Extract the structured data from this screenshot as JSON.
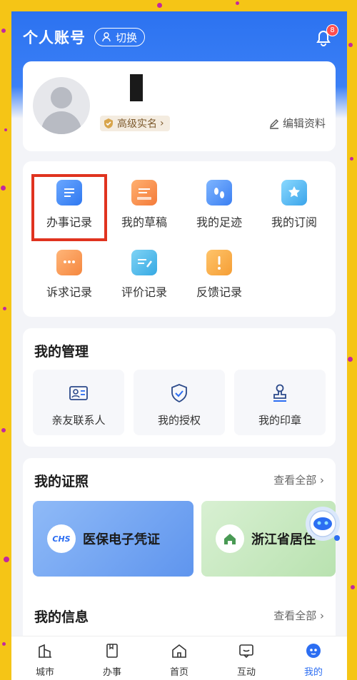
{
  "header": {
    "title": "个人账号",
    "switch_label": "切换",
    "notification_count": "8"
  },
  "profile": {
    "verify_label": "高级实名",
    "edit_label": "编辑资料"
  },
  "records": [
    {
      "label": "办事记录",
      "icon": "document-icon"
    },
    {
      "label": "我的草稿",
      "icon": "draft-icon"
    },
    {
      "label": "我的足迹",
      "icon": "footprint-icon"
    },
    {
      "label": "我的订阅",
      "icon": "bookmark-icon"
    },
    {
      "label": "诉求记录",
      "icon": "chat-icon"
    },
    {
      "label": "评价记录",
      "icon": "review-icon"
    },
    {
      "label": "反馈记录",
      "icon": "feedback-icon"
    }
  ],
  "management": {
    "title": "我的管理",
    "items": [
      {
        "label": "亲友联系人",
        "icon": "contact-card-icon"
      },
      {
        "label": "我的授权",
        "icon": "shield-check-icon"
      },
      {
        "label": "我的印章",
        "icon": "stamp-icon"
      }
    ]
  },
  "license": {
    "title": "我的证照",
    "see_all": "查看全部",
    "cards": [
      {
        "label": "医保电子凭证",
        "logo": "CHS"
      },
      {
        "label": "浙江省居住"
      }
    ]
  },
  "info": {
    "title": "我的信息",
    "see_all": "查看全部"
  },
  "tabbar": [
    {
      "label": "城市",
      "icon": "city-icon"
    },
    {
      "label": "办事",
      "icon": "task-icon"
    },
    {
      "label": "首页",
      "icon": "home-icon"
    },
    {
      "label": "互动",
      "icon": "message-icon"
    },
    {
      "label": "我的",
      "icon": "profile-robot-icon",
      "active": true
    }
  ],
  "colors": {
    "primary": "#2c6ef2",
    "highlight": "#e0331f",
    "frame": "#f5c516"
  }
}
